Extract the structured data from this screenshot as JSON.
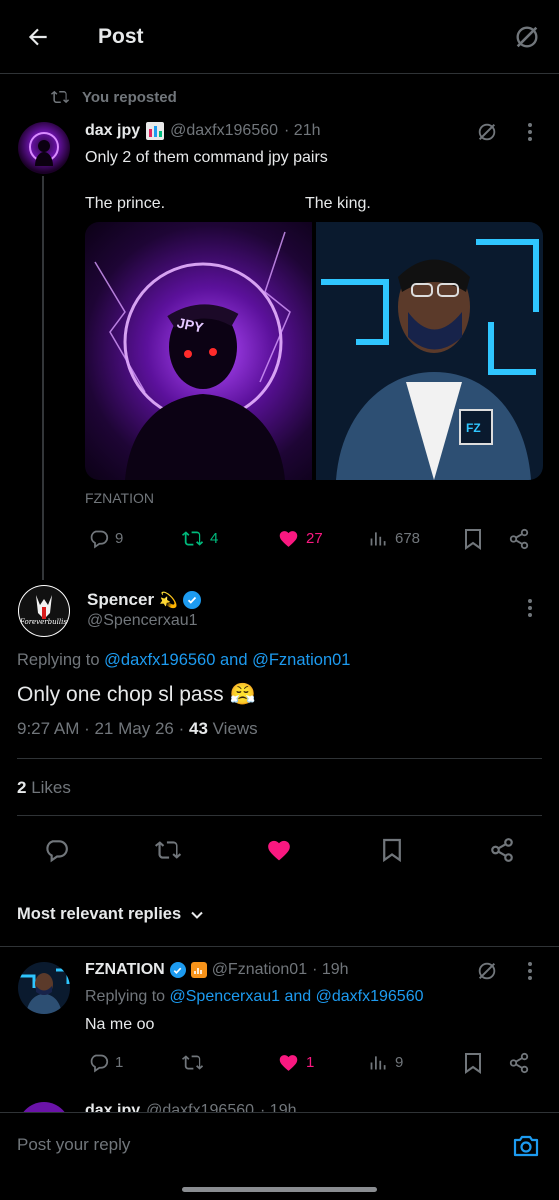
{
  "header": {
    "title": "Post"
  },
  "repost": {
    "label": "You reposted",
    "author": {
      "name": "dax jpy",
      "handle": "@daxfx196560",
      "time": "· 21h"
    },
    "text_line1": "Only 2 of them command jpy pairs",
    "caption_left": "The prince.",
    "caption_right": "The king.",
    "source": "FZNATION",
    "stats": {
      "replies": "9",
      "reposts": "4",
      "likes": "27",
      "views": "678"
    },
    "image_left_text": "JPY",
    "image_right_text": "FZ"
  },
  "main_post": {
    "author": {
      "name": "Spencer",
      "emoji": "💫",
      "handle": "@Spencerxau1",
      "avatar_text": "Foreverbullish"
    },
    "replying_prefix": "Replying to",
    "replying_to": "@daxfx196560 and @Fznation01",
    "text": "Only one chop sl pass 😤",
    "time": "9:27 AM · 21 May 26 ·",
    "views_count": "43",
    "views_label": "Views",
    "likes_count": "2",
    "likes_label": "Likes"
  },
  "replies_sort": {
    "label": "Most relevant replies"
  },
  "reply1": {
    "author": {
      "name": "FZNATION",
      "handle": "@Fznation01",
      "time": "· 19h"
    },
    "replying_prefix": "Replying to",
    "replying_to": "@Spencerxau1 and @daxfx196560",
    "text": "Na me oo",
    "stats": {
      "replies": "1",
      "likes": "1",
      "views": "9"
    }
  },
  "reply2_partial": {
    "name": "dax jpy",
    "handle": "@daxfx196560",
    "time": "· 19h"
  },
  "composer": {
    "placeholder": "Post your reply"
  },
  "colors": {
    "accent": "#1d9bf0",
    "like": "#f91880",
    "repost": "#00ba7c",
    "muted": "#71767b"
  }
}
